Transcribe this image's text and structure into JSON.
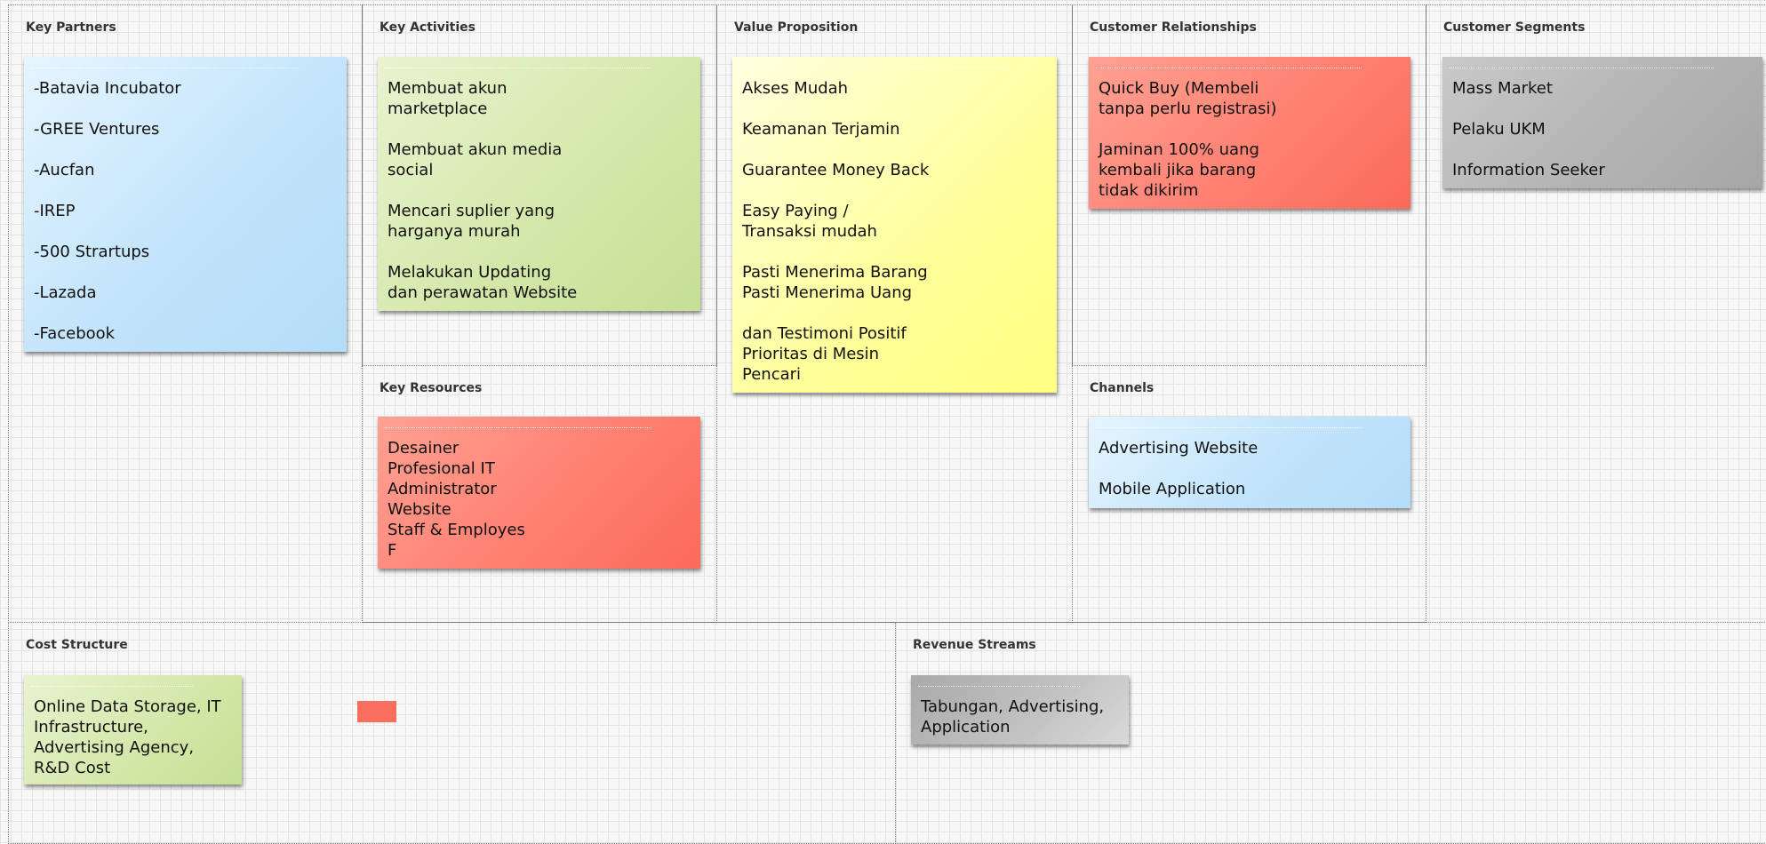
{
  "sections": {
    "key_partners": {
      "title": "Key Partners",
      "items": [
        "-Batavia Incubator",
        "-GREE Ventures",
        "-Aucfan",
        "-IREP",
        "-500 Strartups",
        "-Lazada",
        "-Facebook"
      ]
    },
    "key_activities": {
      "title": "Key Activities",
      "items": [
        "Membuat akun\nmarketplace",
        "Membuat akun media\nsocial",
        "Mencari suplier yang\nharganya murah",
        "Melakukan Updating\ndan perawatan Website"
      ]
    },
    "key_resources": {
      "title": "Key Resources",
      "items": [
        "Desainer",
        "Profesional IT",
        "Administrator",
        "Website",
        "Staff & Employes",
        "F"
      ]
    },
    "value_proposition": {
      "title": "Value Proposition",
      "items": [
        "Akses Mudah",
        "Keamanan Terjamin",
        "Guarantee Money Back",
        "Easy Paying /\nTransaksi mudah",
        "Pasti Menerima Barang\nPasti Menerima Uang",
        "dan Testimoni Positif\nPrioritas di Mesin\nPencari"
      ]
    },
    "customer_relationships": {
      "title": "Customer Relationships",
      "items": [
        "Quick Buy (Membeli\ntanpa perlu registrasi)",
        "Jaminan 100% uang\nkembali jika barang\ntidak dikirim"
      ]
    },
    "channels": {
      "title": "Channels",
      "items": [
        "Advertising Website",
        "Mobile Application"
      ]
    },
    "customer_segments": {
      "title": "Customer Segments",
      "items": [
        "Mass Market",
        "Pelaku UKM",
        "Information Seeker"
      ]
    },
    "cost_structure": {
      "title": "Cost Structure",
      "items": [
        "Online Data Storage, IT\nInfrastructure,\nAdvertising Agency,\nR&D Cost"
      ]
    },
    "revenue_streams": {
      "title": "Revenue Streams",
      "items": [
        "Tabungan, Advertising,\nApplication"
      ]
    }
  },
  "colors": {
    "blue": "#c2e4fb",
    "green": "#d3e7a8",
    "yellow": "#ffff9a",
    "red": "#ff8172",
    "gray": "#b4b4b4"
  }
}
